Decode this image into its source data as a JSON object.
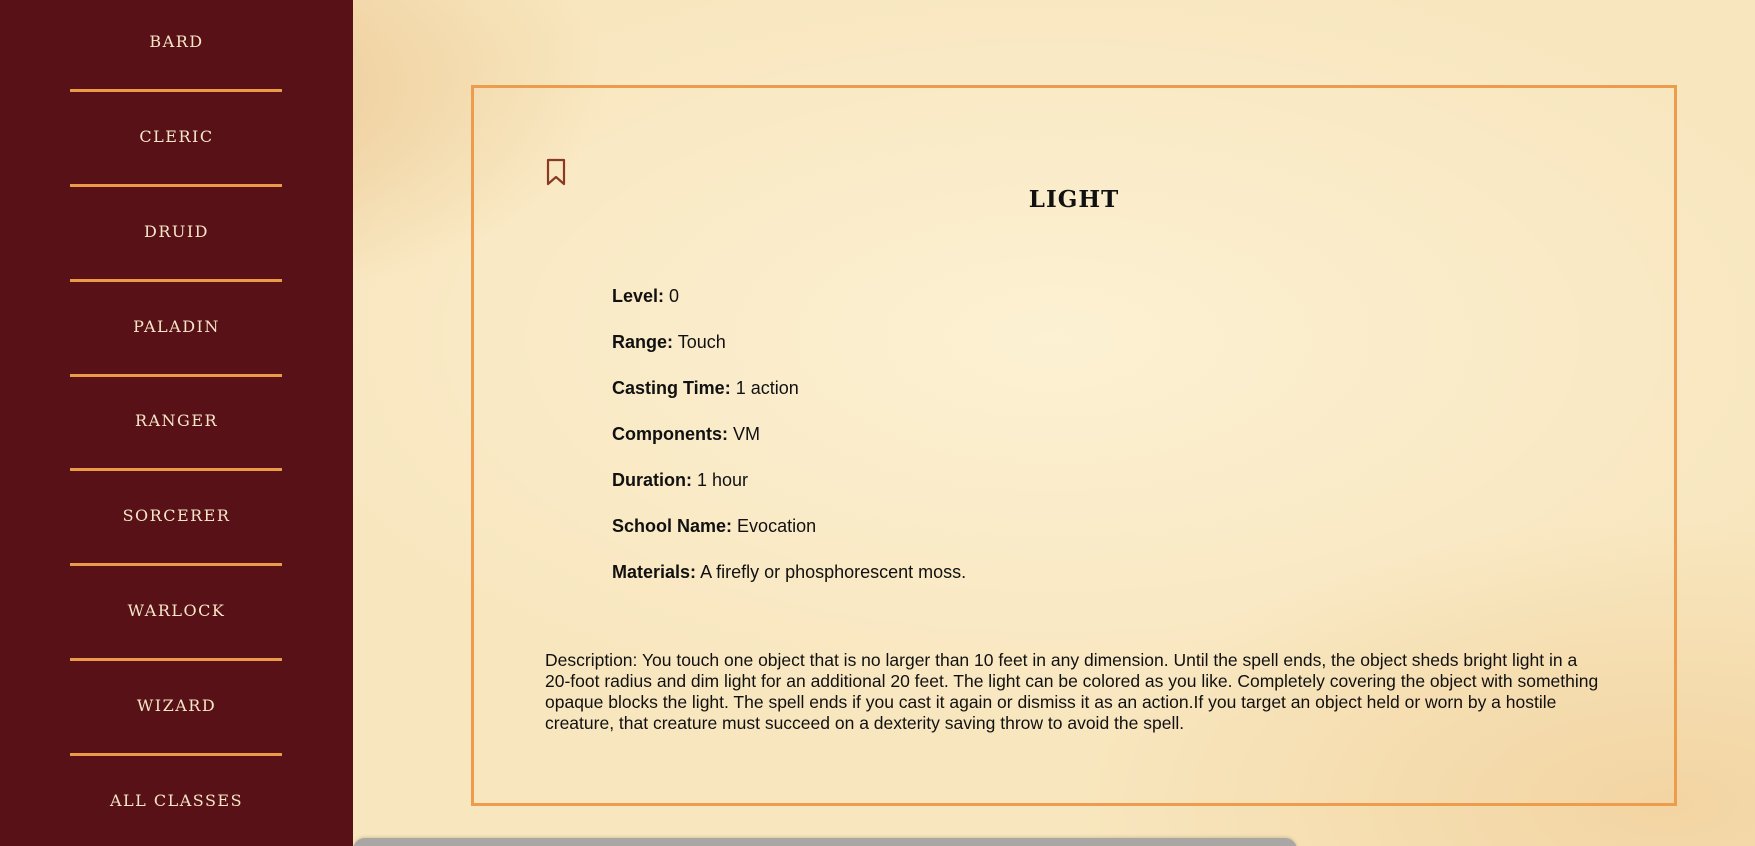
{
  "sidebar": {
    "items": [
      {
        "label": "BARD"
      },
      {
        "label": "CLERIC"
      },
      {
        "label": "DRUID"
      },
      {
        "label": "PALADIN"
      },
      {
        "label": "RANGER"
      },
      {
        "label": "SORCERER"
      },
      {
        "label": "WARLOCK"
      },
      {
        "label": "WIZARD"
      },
      {
        "label": "ALL CLASSES"
      }
    ]
  },
  "spell": {
    "name": "LIGHT",
    "bookmark_icon": "bookmark-icon",
    "stats": [
      {
        "label": "Level:",
        "value": "0"
      },
      {
        "label": "Range:",
        "value": "Touch"
      },
      {
        "label": "Casting Time:",
        "value": "1 action"
      },
      {
        "label": "Components:",
        "value": "VM"
      },
      {
        "label": "Duration:",
        "value": "1 hour"
      },
      {
        "label": "School Name:",
        "value": "Evocation"
      },
      {
        "label": "Materials:",
        "value": "A firefly or phosphorescent moss."
      }
    ],
    "description": "Description: You touch one object that is no larger than 10 feet in any dimension. Until the spell ends, the object sheds bright light in a 20-foot radius and dim light for an additional 20 feet. The light can be colored as you like. Completely covering the object with something opaque blocks the light. The spell ends if you cast it again or dismiss it as an action.If you target an object held or worn by a hostile creature, that creature must succeed on a dexterity saving throw to avoid the spell."
  },
  "colors": {
    "sidebar_bg": "#581116",
    "accent": "#ec9c4c",
    "nav_text": "#f6e6c8",
    "parchment": "#f8e6be"
  }
}
